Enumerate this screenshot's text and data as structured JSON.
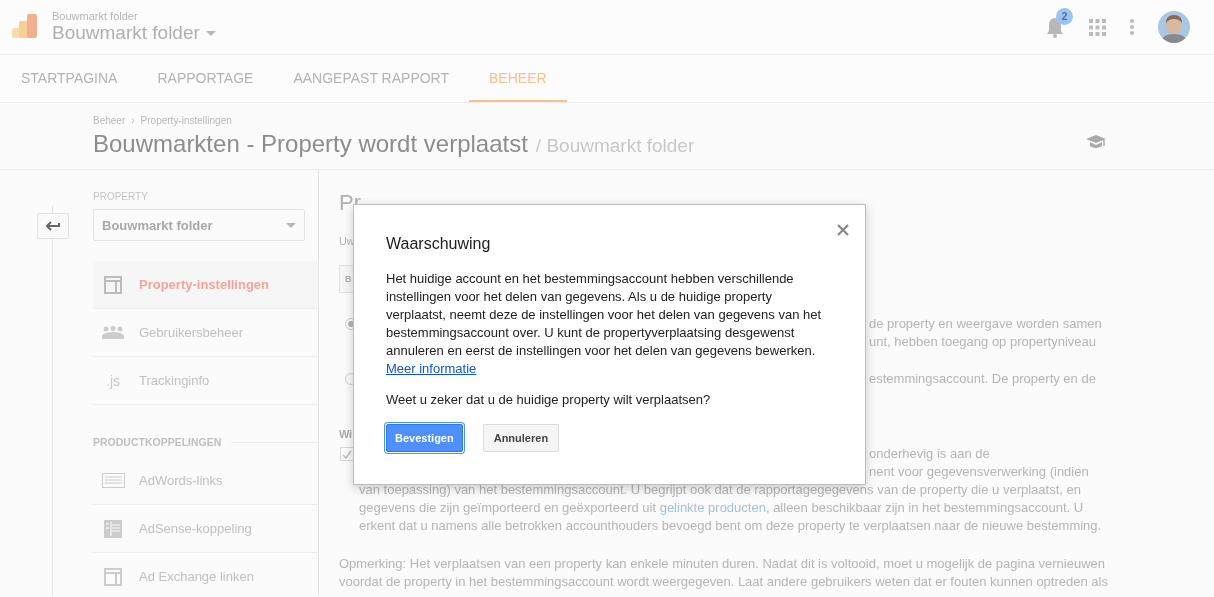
{
  "header": {
    "account": "Bouwmarkt folder",
    "property": "Bouwmarkt folder",
    "notification_count": "2"
  },
  "tabs": [
    {
      "label": "STARTPAGINA",
      "selected": false
    },
    {
      "label": "RAPPORTAGE",
      "selected": false
    },
    {
      "label": "AANGEPAST RAPPORT",
      "selected": false
    },
    {
      "label": "BEHEER",
      "selected": true
    }
  ],
  "breadcrumb": {
    "items": [
      "Beheer",
      "Property-instellingen"
    ],
    "separator": "›"
  },
  "page_title": "Bouwmarkten - Property wordt verplaatst",
  "page_subtitle": "/ Bouwmarkt folder",
  "sidebar": {
    "section_label": "PROPERTY",
    "property_select": "Bouwmarkt folder",
    "items": [
      {
        "label": "Property-instellingen",
        "selected": true
      },
      {
        "label": "Gebruikersbeheer",
        "selected": false
      },
      {
        "label": "Trackinginfo",
        "selected": false,
        "icon_text": ".js"
      }
    ],
    "product_section": "PRODUCTKOPPELINGEN",
    "product_items": [
      {
        "label": "AdWords-links",
        "selected": false
      },
      {
        "label": "AdSense-koppeling",
        "selected": false
      },
      {
        "label": "Ad Exchange linken",
        "selected": false
      }
    ]
  },
  "main": {
    "title": "Pr",
    "intro": "Uw",
    "button": "B",
    "options": [
      {
        "selected": true,
        "lines": [
          "de property en weergave worden samen",
          "unt, hebben toegang op propertyniveau"
        ]
      },
      {
        "selected": false,
        "lines": [
          "estemmingsaccount. De property en de"
        ]
      }
    ],
    "agreement_heading": "Wi",
    "agreement": {
      "checked": true,
      "lines": [
        "onderhevig is aan de",
        "nent voor gegevensverwerking (indien"
      ],
      "before": "van toepassing) van het bestemmingsaccount. U begrijpt ook dat de rapportagegegevens van de property die u verplaatst, en gegevens die zijn geïmporteerd en geëxporteerd uit",
      "link": "gelinkte producten",
      "after": ", alleen beschikbaar zijn in het bestemmingsaccount. U erkent dat u namens alle betrokken accounthouders bevoegd bent om deze property te verplaatsen naar de nieuwe bestemming."
    },
    "note": "Opmerking: Het verplaatsen van een property kan enkele minuten duren. Nadat dit is voltooid, moet u mogelijk de pagina vernieuwen voordat de property in het bestemmingsaccount wordt weergegeven. Laat andere gebruikers weten dat er fouten kunnen optreden als"
  },
  "dialog": {
    "title": "Waarschuwing",
    "body": "Het huidige account en het bestemmingsaccount hebben verschillende instellingen voor het delen van gegevens. Als u de huidige property verplaatst, neemt deze de instellingen voor het delen van gegevens van het bestemmingsaccount over. U kunt de propertyverplaatsing desgewenst annuleren en eerst de instellingen voor het delen van gegevens bewerken.",
    "link": "Meer informatie",
    "question": "Weet u zeker dat u de huidige property wilt verplaatsen?",
    "buttons": [
      {
        "label": "Bevestigen",
        "kind": "primary"
      },
      {
        "label": "Annuleren",
        "kind": "secondary"
      }
    ]
  }
}
